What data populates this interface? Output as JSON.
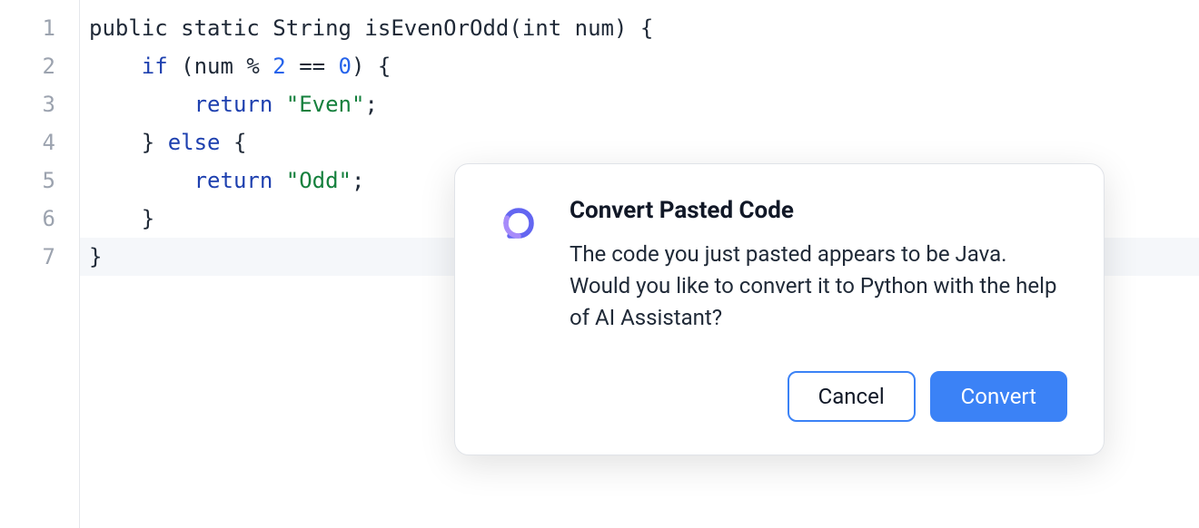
{
  "editor": {
    "lines": [
      {
        "num": "1",
        "tokens": [
          {
            "t": "public static String isEvenOrOdd(int num) {",
            "c": "plain"
          }
        ]
      },
      {
        "num": "2",
        "tokens": [
          {
            "t": "    ",
            "c": "plain"
          },
          {
            "t": "if",
            "c": "kw"
          },
          {
            "t": " (num % ",
            "c": "plain"
          },
          {
            "t": "2",
            "c": "num"
          },
          {
            "t": " == ",
            "c": "plain"
          },
          {
            "t": "0",
            "c": "num"
          },
          {
            "t": ") {",
            "c": "plain"
          }
        ]
      },
      {
        "num": "3",
        "tokens": [
          {
            "t": "        ",
            "c": "plain"
          },
          {
            "t": "return",
            "c": "kw"
          },
          {
            "t": " ",
            "c": "plain"
          },
          {
            "t": "\"Even\"",
            "c": "str"
          },
          {
            "t": ";",
            "c": "plain"
          }
        ]
      },
      {
        "num": "4",
        "tokens": [
          {
            "t": "    } ",
            "c": "plain"
          },
          {
            "t": "else",
            "c": "kw"
          },
          {
            "t": " {",
            "c": "plain"
          }
        ]
      },
      {
        "num": "5",
        "tokens": [
          {
            "t": "        ",
            "c": "plain"
          },
          {
            "t": "return",
            "c": "kw"
          },
          {
            "t": " ",
            "c": "plain"
          },
          {
            "t": "\"Odd\"",
            "c": "str"
          },
          {
            "t": ";",
            "c": "plain"
          }
        ]
      },
      {
        "num": "6",
        "tokens": [
          {
            "t": "    }",
            "c": "plain"
          }
        ]
      },
      {
        "num": "7",
        "tokens": [
          {
            "t": "}",
            "c": "plain"
          }
        ],
        "highlighted": true
      }
    ]
  },
  "dialog": {
    "title": "Convert Pasted Code",
    "body": "The code you just pasted appears to be Java. Would you like to convert it to Python with the help of AI Assistant?",
    "cancel": "Cancel",
    "confirm": "Convert"
  }
}
